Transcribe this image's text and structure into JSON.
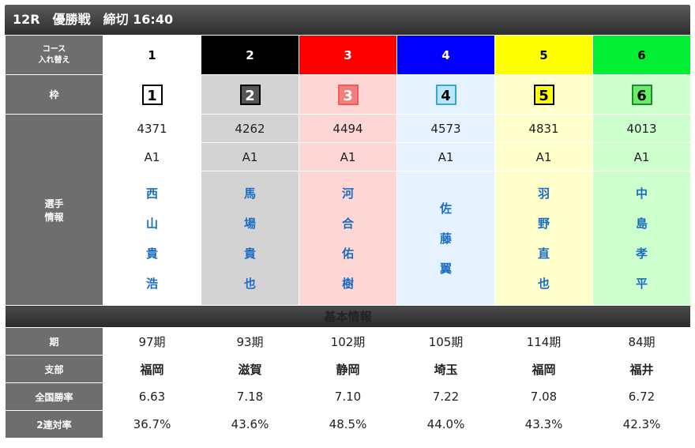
{
  "header": {
    "title": "12R　優勝戦　締切 16:40"
  },
  "labels": {
    "course": "コース",
    "course_sub": "入れ替え",
    "waku": "枠",
    "player": "選手",
    "player_sub": "情報",
    "basic_info": "基本情報",
    "ki": "期",
    "branch": "支部",
    "win_rate": "全国勝率",
    "two_rate": "2連対率"
  },
  "colors": {
    "course_bg": [
      "#ffffff",
      "#000000",
      "#ff0000",
      "#0000ff",
      "#ffff00",
      "#00ee33"
    ],
    "course_fg": [
      "#000000",
      "#ffffff",
      "#ffffff",
      "#ffffff",
      "#000000",
      "#000000"
    ],
    "col_bg": [
      "#ffffff",
      "#d3d3d3",
      "#ffd6d6",
      "#e6f2ff",
      "#ffffcc",
      "#ccffcc"
    ],
    "waku_bg": [
      "#ffffff",
      "#555555",
      "#f08080",
      "#b8e8ff",
      "#ffff00",
      "#66ee66"
    ],
    "waku_fg": [
      "#000000",
      "#ffffff",
      "#ffffff",
      "#000000",
      "#000000",
      "#000000"
    ],
    "waku_border": [
      "#000000",
      "#000000",
      "#ff5555",
      "#33aadd",
      "#000000",
      "#228833"
    ],
    "name_color": "#1a6dc4"
  },
  "racers": [
    {
      "course": "1",
      "waku": "1",
      "reg": "4371",
      "grade": "A1",
      "name": "西山貴浩",
      "ki": "97期",
      "branch": "福岡",
      "win_rate": "6.63",
      "two_rate": "36.7%"
    },
    {
      "course": "2",
      "waku": "2",
      "reg": "4262",
      "grade": "A1",
      "name": "馬場貴也",
      "ki": "93期",
      "branch": "滋賀",
      "win_rate": "7.18",
      "two_rate": "43.6%"
    },
    {
      "course": "3",
      "waku": "3",
      "reg": "4494",
      "grade": "A1",
      "name": "河合佑樹",
      "ki": "102期",
      "branch": "静岡",
      "win_rate": "7.10",
      "two_rate": "48.5%"
    },
    {
      "course": "4",
      "waku": "4",
      "reg": "4573",
      "grade": "A1",
      "name": "佐藤翼",
      "ki": "105期",
      "branch": "埼玉",
      "win_rate": "7.22",
      "two_rate": "44.0%"
    },
    {
      "course": "5",
      "waku": "5",
      "reg": "4831",
      "grade": "A1",
      "name": "羽野直也",
      "ki": "114期",
      "branch": "福岡",
      "win_rate": "7.08",
      "two_rate": "43.3%"
    },
    {
      "course": "6",
      "waku": "6",
      "reg": "4013",
      "grade": "A1",
      "name": "中島孝平",
      "ki": "84期",
      "branch": "福井",
      "win_rate": "6.72",
      "two_rate": "42.3%"
    }
  ]
}
